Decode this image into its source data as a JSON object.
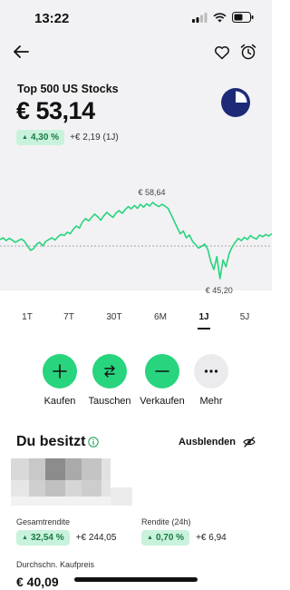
{
  "status": {
    "time": "13:22"
  },
  "instrument": {
    "name": "Top 500 US Stocks",
    "price": "€ 53,14"
  },
  "change": {
    "percent": "4,30 %",
    "absolute": "+€ 2,19 (1J)"
  },
  "chart_data": {
    "type": "line",
    "annotations": {
      "high": "€ 58,64",
      "low": "€ 45,20"
    },
    "high": 58.64,
    "low": 45.2,
    "color": "#28d47e",
    "y": [
      52.1,
      52.4,
      51.9,
      52.3,
      52.0,
      51.6,
      51.9,
      52.2,
      51.8,
      51.0,
      50.2,
      50.5,
      51.3,
      51.6,
      51.0,
      51.8,
      52.1,
      52.4,
      52.0,
      52.6,
      53.0,
      52.8,
      53.4,
      53.1,
      53.9,
      54.5,
      54.1,
      55.2,
      55.8,
      55.4,
      56.0,
      56.6,
      56.1,
      55.5,
      56.3,
      56.9,
      56.4,
      56.0,
      56.8,
      57.2,
      56.7,
      57.4,
      57.9,
      57.5,
      58.1,
      57.6,
      58.3,
      57.8,
      58.4,
      58.0,
      58.64,
      58.2,
      57.9,
      58.3,
      58.0,
      57.6,
      56.5,
      55.4,
      54.2,
      53.1,
      53.6,
      52.4,
      52.9,
      51.8,
      51.2,
      50.6,
      50.9,
      51.3,
      50.4,
      48.2,
      46.8,
      49.1,
      45.2,
      48.5,
      47.3,
      49.6,
      50.8,
      51.6,
      52.3,
      51.9,
      52.5,
      52.1,
      52.8,
      52.4,
      52.2,
      52.9,
      52.6,
      53.0,
      52.7,
      53.14
    ],
    "baseline": 50.95
  },
  "ranges": [
    "1T",
    "7T",
    "30T",
    "6M",
    "1J",
    "5J"
  ],
  "active_range": "1J",
  "actions": [
    {
      "label": "Kaufen",
      "icon": "plus-icon"
    },
    {
      "label": "Tauschen",
      "icon": "swap-icon"
    },
    {
      "label": "Verkaufen",
      "icon": "minus-icon"
    },
    {
      "label": "Mehr",
      "icon": "more-icon"
    }
  ],
  "holdings": {
    "title": "Du besitzt",
    "hide_label": "Ausblenden",
    "total_return_label": "Gesamtrendite",
    "total_return_percent": "32,54 %",
    "total_return_abs": "+€ 244,05",
    "return24_label": "Rendite (24h)",
    "return24_percent": "0,70 %",
    "return24_abs": "+€ 6,94",
    "avg_price_label": "Durchschn. Kaufpreis",
    "avg_price": "€ 40,09"
  },
  "colors": {
    "accent": "#28d47e",
    "pill_bg": "#c9f2dc",
    "pill_text": "#1a7a44",
    "logo": "#1e2a78"
  }
}
